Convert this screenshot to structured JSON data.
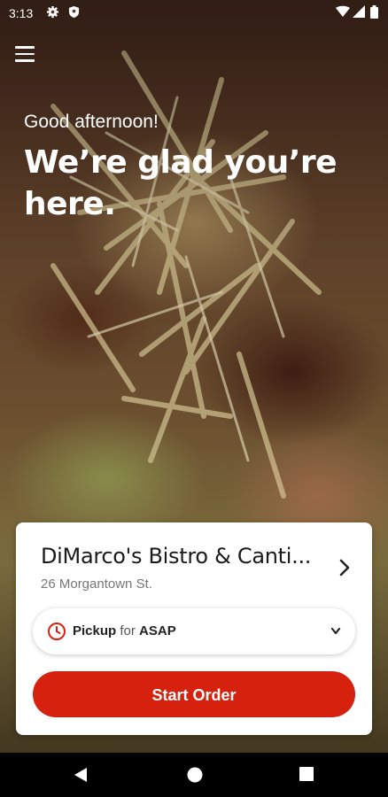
{
  "status_bar": {
    "time": "3:13"
  },
  "hero": {
    "greeting": "Good afternoon!",
    "headline": "We’re glad you’re here."
  },
  "restaurant": {
    "name": "DiMarco's Bistro & Canti...",
    "address": "26 Morgantown St."
  },
  "order_mode": {
    "mode": "Pickup",
    "connector": "for",
    "time": "ASAP"
  },
  "actions": {
    "start_order_label": "Start Order"
  },
  "colors": {
    "accent": "#d6210f",
    "text_dark": "#1a1a1a",
    "text_muted": "#777777"
  },
  "icons": [
    "gear-icon",
    "shield-icon",
    "wifi-icon",
    "signal-icon",
    "battery-icon",
    "menu-icon",
    "chevron-right-icon",
    "clock-icon",
    "chevron-down-icon",
    "back-icon",
    "home-icon",
    "recents-icon"
  ]
}
